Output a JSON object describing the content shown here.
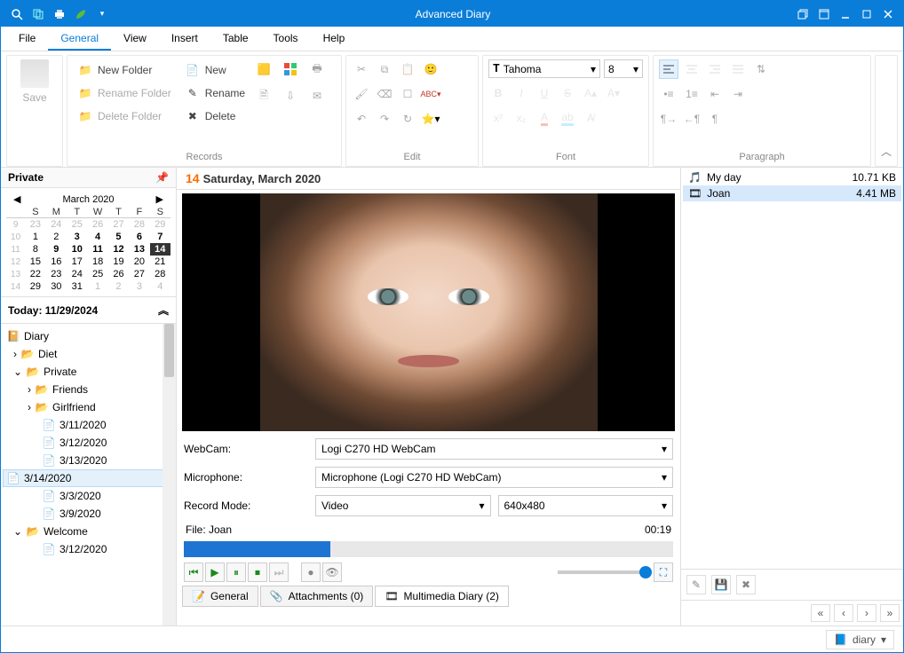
{
  "app": {
    "title": "Advanced Diary"
  },
  "menu": {
    "file": "File",
    "general": "General",
    "view": "View",
    "insert": "Insert",
    "table": "Table",
    "tools": "Tools",
    "help": "Help"
  },
  "ribbon": {
    "save": "Save",
    "records": {
      "new_folder": "New Folder",
      "rename_folder": "Rename Folder",
      "delete_folder": "Delete Folder",
      "new": "New",
      "rename": "Rename",
      "delete": "Delete",
      "label": "Records"
    },
    "edit": {
      "label": "Edit"
    },
    "font": {
      "name": "Tahoma",
      "size": "8",
      "label": "Font"
    },
    "paragraph": {
      "label": "Paragraph"
    }
  },
  "left": {
    "header": "Private",
    "cal": {
      "month": "March 2020",
      "dow": [
        "S",
        "M",
        "T",
        "W",
        "T",
        "F",
        "S"
      ],
      "weeks": [
        {
          "wk": "9",
          "d": [
            "23",
            "24",
            "25",
            "26",
            "27",
            "28",
            "29"
          ],
          "dim": true
        },
        {
          "wk": "10",
          "d": [
            "1",
            "2",
            "3",
            "4",
            "5",
            "6",
            "7"
          ],
          "bold": [
            2,
            3,
            4,
            5,
            6
          ]
        },
        {
          "wk": "11",
          "d": [
            "8",
            "9",
            "10",
            "11",
            "12",
            "13",
            "14"
          ],
          "bold": [
            1,
            2,
            3,
            4,
            5,
            6
          ],
          "sel": 6
        },
        {
          "wk": "12",
          "d": [
            "15",
            "16",
            "17",
            "18",
            "19",
            "20",
            "21"
          ]
        },
        {
          "wk": "13",
          "d": [
            "22",
            "23",
            "24",
            "25",
            "26",
            "27",
            "28"
          ]
        },
        {
          "wk": "14",
          "d": [
            "29",
            "30",
            "31",
            "1",
            "2",
            "3",
            "4"
          ],
          "dimfrom": 3
        }
      ]
    },
    "today": "Today: 11/29/2024",
    "tree": {
      "root": "Diary",
      "diet": "Diet",
      "private": "Private",
      "friends": "Friends",
      "girlfriend": "Girlfriend",
      "d1": "3/11/2020",
      "d2": "3/12/2020",
      "d3": "3/13/2020",
      "d4": "3/14/2020",
      "d5": "3/3/2020",
      "d6": "3/9/2020",
      "welcome": "Welcome",
      "w1": "3/12/2020"
    }
  },
  "center": {
    "daynum": "14",
    "daylabel": "Saturday, March 2020",
    "webcam_l": "WebCam:",
    "mic_l": "Microphone:",
    "mode_l": "Record Mode:",
    "webcam": "Logi C270 HD WebCam",
    "mic": "Microphone (Logi C270 HD WebCam)",
    "mode": "Video",
    "res": "640x480",
    "file_l": "File: Joan",
    "time": "00:19",
    "tabs": {
      "general": "General",
      "attach": "Attachments (0)",
      "multi": "Multimedia Diary (2)"
    }
  },
  "right": {
    "files": [
      {
        "name": "My day",
        "size": "10.71 KB",
        "icon": "audio"
      },
      {
        "name": "Joan",
        "size": "4.41 MB",
        "icon": "video",
        "sel": true
      }
    ]
  },
  "status": {
    "diary": "diary"
  }
}
